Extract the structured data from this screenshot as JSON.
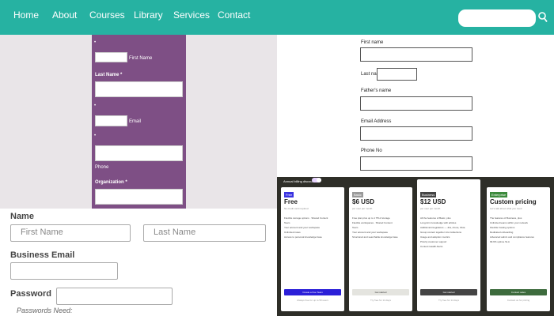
{
  "nav": {
    "items": [
      "Home",
      "About",
      "Courses",
      "Library",
      "Services",
      "Contact"
    ]
  },
  "left_form": {
    "first_name_label": "First Name",
    "last_name_label": "Last Name *",
    "email_label": "Email",
    "phone_label": "Phone",
    "organization_label": "Organization *"
  },
  "signup": {
    "name_label": "Name",
    "first_placeholder": "First Name",
    "last_placeholder": "Last Name",
    "email_label": "Business Email",
    "password_label": "Password",
    "password_hint": "Passwords Need:"
  },
  "right_form": {
    "first_name": "First name",
    "last_name": "Last name",
    "father_name": "Father's name",
    "email": "Email Address",
    "phone": "Phone No"
  },
  "pricing": {
    "toggle_label": "Annual billing discount",
    "cards": [
      {
        "badge": "Free",
        "badge_color": "#3a33e0",
        "title": "Free",
        "sub": "No credit card required",
        "features": [
          "Flexible storage options · Shared Content",
          "Team",
          "Your account and your workspace",
          "Unlimited notes",
          "Access to personal knowledge base"
        ],
        "button": "Create a free Team",
        "button_bg": "#2b1fd8",
        "button_color": "#fff",
        "foot": "Always free for up to 50 users"
      },
      {
        "badge": "Basic",
        "badge_color": "#9a9a9a",
        "title": "$6 USD",
        "sub": "per user per month",
        "features": [
          "Free plan plus up to 1 TB of storage",
          "Flexible workspaces · Shared Content",
          "Team",
          "Your account and your workspace",
          "Structured and searchable knowledge base"
        ],
        "button": "Get started",
        "button_bg": "#e4e4df",
        "button_color": "#333",
        "foot": "Try free for 14 days"
      },
      {
        "badge": "Business",
        "badge_color": "#444",
        "title": "$12 USD",
        "sub": "per user per month",
        "features": [
          "All the features of Basic, plus",
          "Long-form knowledge with articles",
          "Additional integrations — Jira, Azure, Okta",
          "Group content together into Collections",
          "Usage and adoption metrics",
          "Priority customer support",
          "Content Health Alerts"
        ],
        "button": "Get started",
        "button_bg": "#444",
        "button_color": "#fff",
        "foot": "Try free for 14 days"
      },
      {
        "badge": "Enterprise",
        "badge_color": "#3c8a3c",
        "title": "Custom pricing",
        "sub": "Let's talk about what you need",
        "features": [
          "The features of Business, plus",
          "Unlimited teams within your network",
          "Flexible hosting options",
          "Dedicated onboarding",
          "Advanced admin and compliance features",
          "99.9% uptime SLA"
        ],
        "button": "Contact sales",
        "button_bg": "#3d6b3d",
        "button_color": "#fff",
        "foot": "Contact us for pricing"
      }
    ]
  }
}
